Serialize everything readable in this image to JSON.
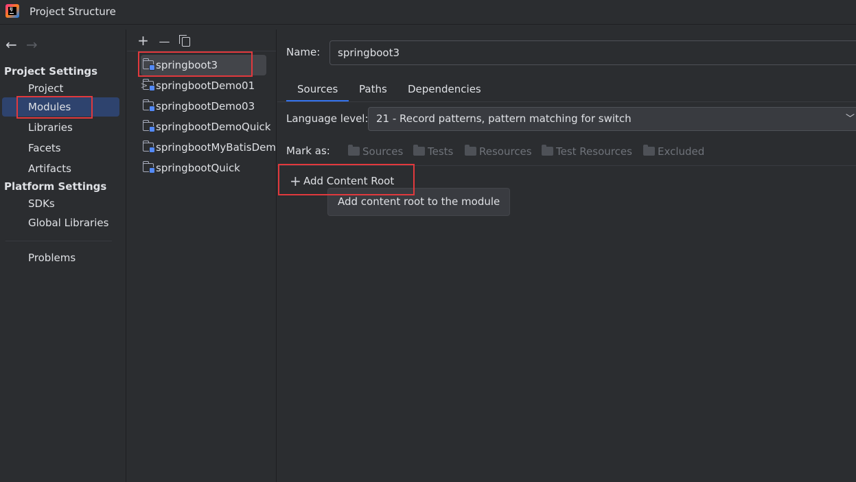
{
  "window": {
    "title": "Project Structure"
  },
  "nav": {
    "back_icon": "arrow-left-icon",
    "forward_icon": "arrow-right-icon",
    "project_settings_title": "Project Settings",
    "project_items": [
      "Project",
      "Modules",
      "Libraries",
      "Facets",
      "Artifacts"
    ],
    "platform_settings_title": "Platform Settings",
    "platform_items": [
      "SDKs",
      "Global Libraries"
    ],
    "problems": "Problems",
    "selected": "Modules"
  },
  "modules": {
    "toolbar": {
      "add": "+",
      "remove": "—"
    },
    "items": [
      "springboot3",
      "springbootDemo01",
      "springbootDemo03",
      "springbootDemoQuick",
      "springbootMyBatisDemo",
      "springbootQuick"
    ],
    "selected": "springboot3"
  },
  "details": {
    "name_label": "Name:",
    "name_value": "springboot3",
    "tabs": [
      "Sources",
      "Paths",
      "Dependencies"
    ],
    "active_tab": "Sources",
    "language_level_label": "Language level:",
    "language_level_value": "21 - Record patterns, pattern matching for switch",
    "mark_as_label": "Mark as:",
    "mark_as_buttons": [
      "Sources",
      "Tests",
      "Resources",
      "Test Resources",
      "Excluded"
    ],
    "add_content_root": "Add Content Root",
    "tooltip": "Add content root to the module"
  },
  "colors": {
    "background": "#2b2d30",
    "selection": "#2e436e",
    "accent": "#3574f0",
    "annotation": "#e2393d"
  }
}
